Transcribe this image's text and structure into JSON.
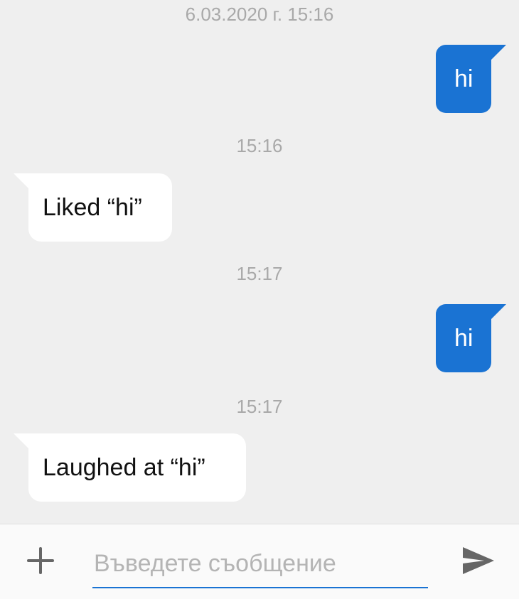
{
  "thread": {
    "date_header": "6.03.2020 г. 15:16",
    "messages": [
      {
        "direction": "outgoing",
        "text": "hi"
      },
      {
        "timestamp": "15:16",
        "direction": "incoming",
        "text": "Liked “hi”"
      },
      {
        "timestamp": "15:17",
        "direction": "outgoing",
        "text": "hi"
      },
      {
        "timestamp": "15:17",
        "direction": "incoming",
        "text": "Laughed at “hi”"
      }
    ]
  },
  "composer": {
    "placeholder": "Въведете съобщение",
    "value": "",
    "add_icon": "plus-icon",
    "send_icon": "send-icon"
  },
  "colors": {
    "background": "#efefef",
    "outgoing_bubble": "#1a73d3",
    "incoming_bubble": "#ffffff",
    "timestamp_text": "#a9a9a9",
    "input_underline": "#1a73d3"
  }
}
